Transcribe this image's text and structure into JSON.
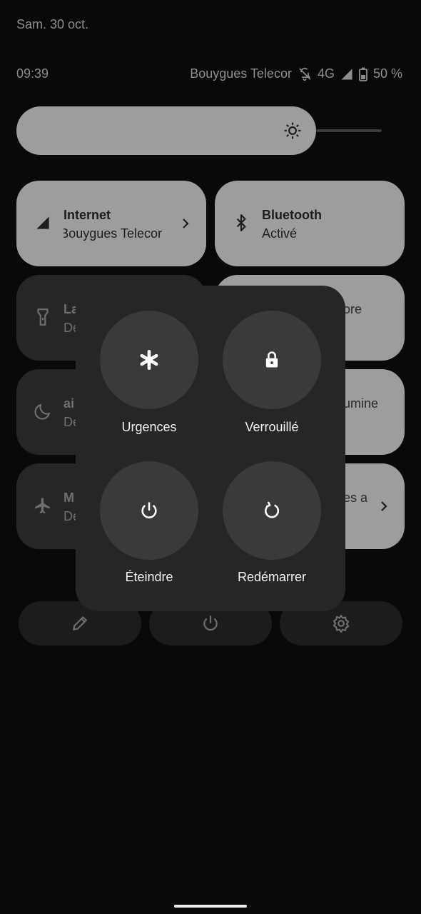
{
  "status_bar": {
    "date": "Sam. 30 oct.",
    "time": "09:39",
    "carrier": "Bouygues Telecor",
    "network": "4G",
    "battery": "50 %",
    "icons": [
      "muted-bell-icon",
      "signal-icon",
      "battery-icon"
    ]
  },
  "brightness": {
    "icon": "brightness-icon"
  },
  "tiles": {
    "internet": {
      "title": "Internet",
      "subtitle": "Bouygues Telecor",
      "icon": "signal-icon"
    },
    "bluetooth": {
      "title": "Bluetooth",
      "subtitle": "Activé",
      "icon": "bluetooth-icon"
    },
    "flashlight": {
      "title": "La",
      "subtitle": "De",
      "icon": "flashlight-icon"
    },
    "tile_right_2": {
      "title": "ore"
    },
    "night": {
      "title": "ai",
      "subtitle": "De",
      "icon": "moon-icon"
    },
    "tile_right_3": {
      "title": "umine"
    },
    "airplane": {
      "title": "M",
      "subtitle": "De",
      "icon": "airplane-icon"
    },
    "tile_right_4": {
      "title": "es a"
    }
  },
  "bottom_bar": {
    "icons": [
      "edit-icon",
      "power-icon",
      "settings-icon"
    ]
  },
  "power_menu": {
    "emergency": "Urgences",
    "lockdown": "Verrouillé",
    "power_off": "Éteindre",
    "restart": "Redémarrer"
  }
}
